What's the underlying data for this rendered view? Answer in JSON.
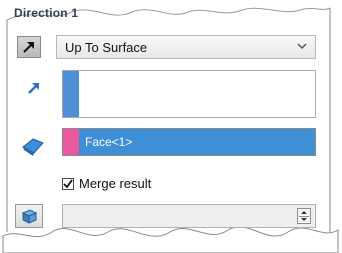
{
  "panel": {
    "title": "Direction 1",
    "end_condition": {
      "value": "Up To Surface"
    },
    "face_selection": {
      "value": "Face<1>"
    },
    "merge_result": {
      "label": "Merge result",
      "checked": true
    },
    "accent_colors": {
      "selection_blue": "#4f8fd3",
      "face_pink": "#e85a9d",
      "face_highlight": "#3f8fd6"
    }
  },
  "icons": {
    "reverse_direction": "arrow-diagonal-icon",
    "direction_of_extrusion": "blue-arrow-icon",
    "face_vertex": "surface-selection-icon",
    "feature_scope": "solid-body-icon",
    "dropdown": "chevron-down-icon",
    "spinner": "spinner-up-down-icon"
  }
}
